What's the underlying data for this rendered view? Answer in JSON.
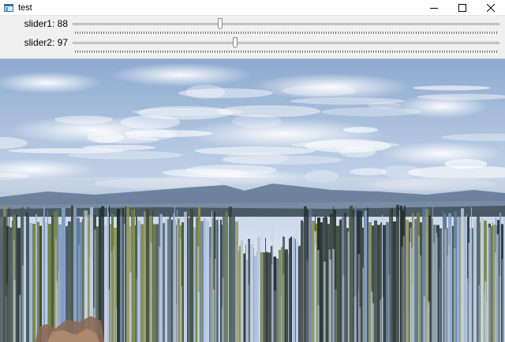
{
  "window": {
    "title": "test",
    "minimize_icon": "minimize-icon",
    "maximize_icon": "maximize-icon",
    "close_icon": "close-icon"
  },
  "trackbars": [
    {
      "label": "slider1: 88",
      "value": 88,
      "max": 255
    },
    {
      "label": "slider2: 97",
      "value": 97,
      "max": 255
    }
  ],
  "image": {
    "description_icon": "glitched-landscape-image",
    "colors": {
      "sky_top": "#93aed1",
      "sky_mid": "#cfdbec",
      "horizon": "#e8eef6",
      "mountains": "#5f7690",
      "streak_dark": "#1f2a2c",
      "streak_blue": "#7f9cc2",
      "streak_green": "#6d7a3b"
    }
  }
}
